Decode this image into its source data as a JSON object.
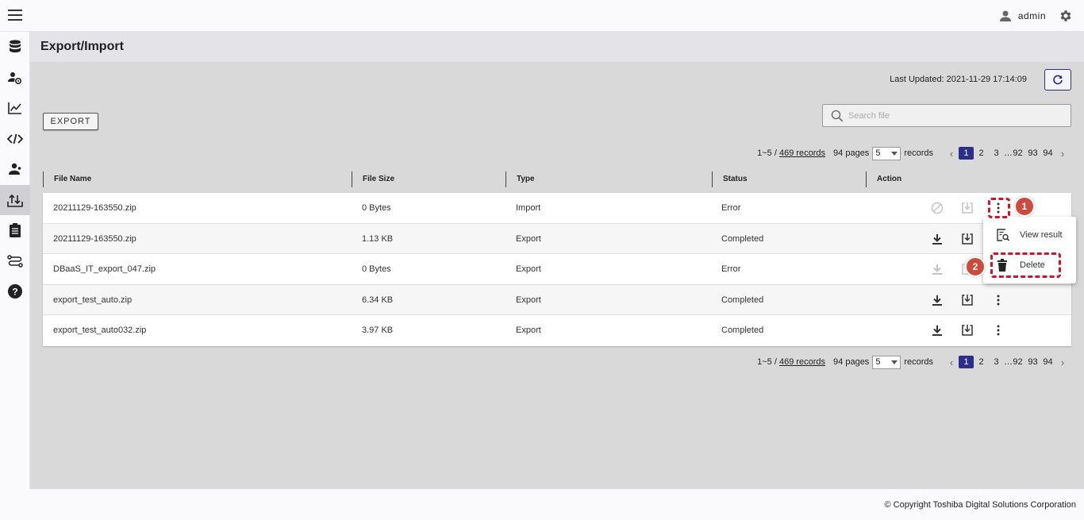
{
  "user": {
    "name": "admin"
  },
  "page": {
    "title": "Export/Import"
  },
  "toolbar": {
    "last_updated": "Last Updated: 2021-11-29 17:14:09",
    "export_label": "EXPORT",
    "search_placeholder": "Search file"
  },
  "pagination": {
    "range": "1~5 / ",
    "records_link": "469 records",
    "pages": "94 pages",
    "page_size": "5",
    "records_label": "records",
    "pages_list": [
      "1",
      "2",
      "3",
      "...",
      "92",
      "93",
      "94"
    ],
    "current_page": "1"
  },
  "table": {
    "headers": [
      "File Name",
      "File Size",
      "Type",
      "Status",
      "Action"
    ],
    "rows": [
      {
        "file": "20211129-163550.zip",
        "size": "0 Bytes",
        "type": "Import",
        "status": "Error"
      },
      {
        "file": "20211129-163550.zip",
        "size": "1.13 KB",
        "type": "Export",
        "status": "Completed"
      },
      {
        "file": "DBaaS_IT_export_047.zip",
        "size": "0 Bytes",
        "type": "Export",
        "status": "Error"
      },
      {
        "file": "export_test_auto.zip",
        "size": "6.34 KB",
        "type": "Export",
        "status": "Completed"
      },
      {
        "file": "export_test_auto032.zip",
        "size": "3.97 KB",
        "type": "Export",
        "status": "Completed"
      }
    ]
  },
  "context_menu": {
    "view_result": "View result",
    "delete": "Delete"
  },
  "annotations": {
    "step1": "1",
    "step2": "2"
  },
  "footer": {
    "copyright": "© Copyright Toshiba Digital Solutions Corporation"
  },
  "colors": {
    "primary": "#2d2d8a",
    "callout": "#d0152b",
    "badge": "#cd4a3f",
    "content_bg": "#d9d9d9"
  }
}
